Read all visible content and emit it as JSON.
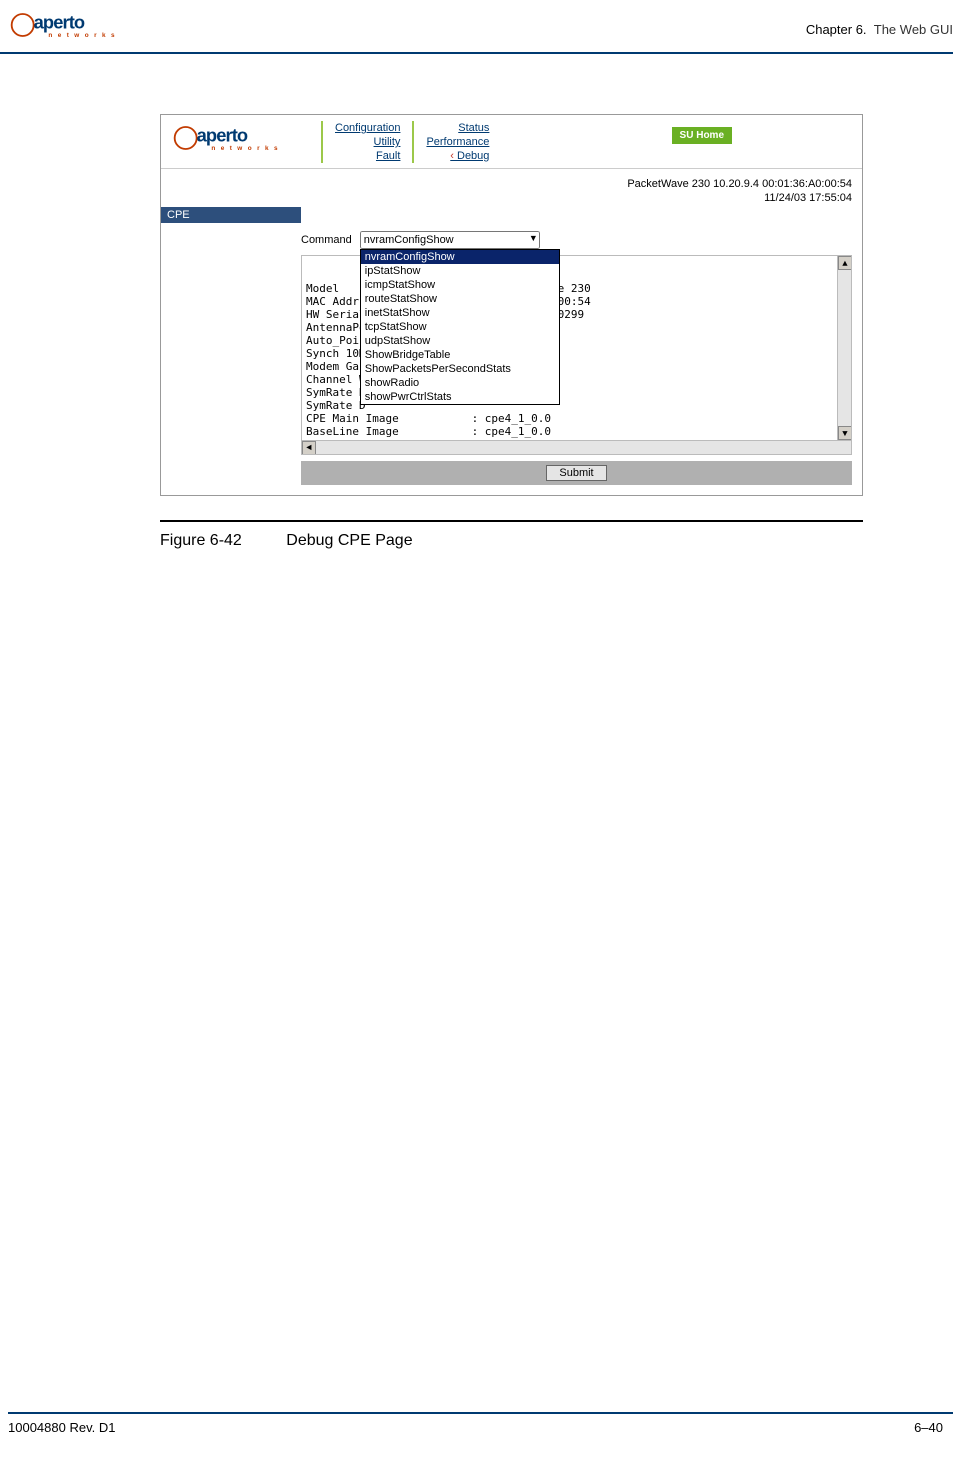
{
  "doc": {
    "chapter_prefix": "Chapter 6.",
    "chapter_title": "The Web GUI",
    "footer_left": "10004880 Rev. D1",
    "footer_right": "6–40"
  },
  "logo": {
    "main": "aperto",
    "sub": "n e t w o r k s"
  },
  "screenshot": {
    "nav": {
      "col1": [
        "Configuration",
        "Utility",
        "Fault"
      ],
      "col2": [
        "Status",
        "Performance",
        "Debug"
      ],
      "active": "Debug",
      "home_label": "SU Home"
    },
    "infobar": {
      "line1": "PacketWave 230    10.20.9.4    00:01:36:A0:00:54",
      "line2": "11/24/03    17:55:04"
    },
    "section_label": "CPE",
    "command_label": "Command",
    "command_value": "nvramConfigShow",
    "dropdown_options": [
      "nvramConfigShow",
      "ipStatShow",
      "icmpStatShow",
      "routeStatShow",
      "inetStatShow",
      "tcpStatShow",
      "udpStatShow",
      "ShowBridgeTable",
      "ShowPacketsPerSecondStats",
      "showRadio",
      "showPwrCtrlStats"
    ],
    "output": "Model                                ve 230\nMAC Addr                          :a0:00:54\nHW Serial                         50000299\nAntennaPoi\nAuto_Poin\nSynch 10M\nModem Gai\nChannel W\nSymRate N\nSymRate D\nCPE Main Image           : cpe4_1_0.0\nBaseLine Image           : cpe4_1_0.0\nBoot baseLine            : FALSE\nBootFrom Flash           : TRUE\nFlash Updates            : 317\nLan IP Address           : 10.20.9.4    Mask:0xffffff00\nDebug Flag               : 0x0          Nvram Version: 4.1.1\nConsole2Ether            : TRUE\nReset on Error           : TRUE\nWindview Logging Enabled : FALSE",
    "submit_label": "Submit"
  },
  "figure": {
    "number": "Figure 6-42",
    "title": "Debug CPE Page"
  }
}
